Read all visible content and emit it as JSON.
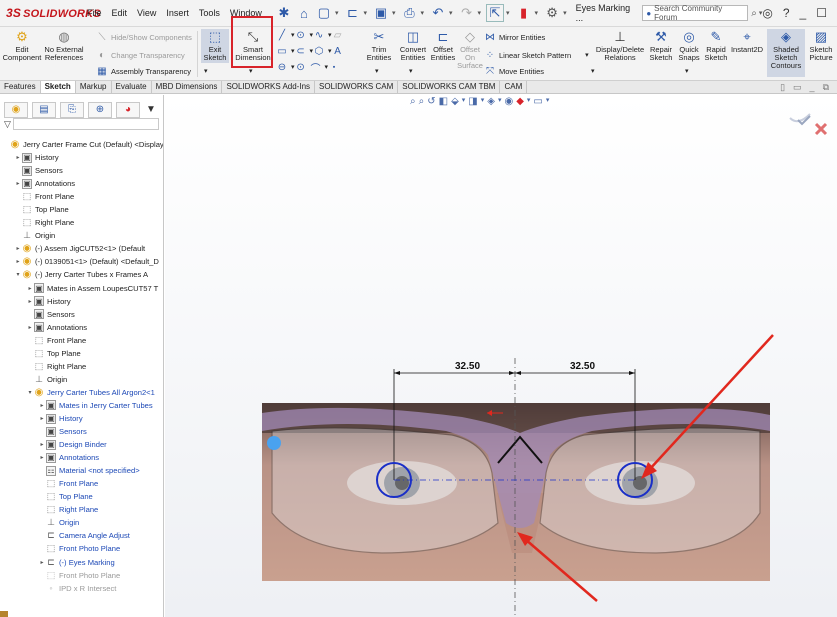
{
  "app": {
    "brand": "SOLIDWORKS",
    "brand_prefix": "3S"
  },
  "menu": [
    "File",
    "Edit",
    "View",
    "Insert",
    "Tools",
    "Window"
  ],
  "doc_title": "Eyes Marking ...",
  "search": {
    "placeholder": "Search Community Forum"
  },
  "ribbon": {
    "edit_component": "Edit Component",
    "no_external_refs": "No External References",
    "hide_show": "Hide/Show Components",
    "change_transparency": "Change Transparency",
    "assembly_transparency": "Assembly Transparency",
    "exit_sketch": "Exit Sketch",
    "smart_dimension": "Smart Dimension",
    "trim": "Trim Entities",
    "convert": "Convert Entities",
    "offset": "Offset Entities",
    "offset_surface": "Offset On Surface",
    "mirror": "Mirror Entities",
    "linear_pattern": "Linear Sketch Pattern",
    "move": "Move Entities",
    "display_delete": "Display/Delete Relations",
    "repair": "Repair Sketch",
    "quick_snaps": "Quick Snaps",
    "rapid": "Rapid Sketch",
    "instant2d": "Instant2D",
    "shaded": "Shaded Sketch Contours",
    "sketch_picture": "Sketch Picture"
  },
  "tabs": [
    "Features",
    "Sketch",
    "Markup",
    "Evaluate",
    "MBD Dimensions",
    "SOLIDWORKS Add-Ins",
    "SOLIDWORKS CAM",
    "SOLIDWORKS CAM TBM",
    "CAM"
  ],
  "active_tab": "Sketch",
  "tree": [
    {
      "label": "Jerry Carter Frame Cut (Default) <Display",
      "indent": 0,
      "icon": "part",
      "arrow": ""
    },
    {
      "label": "History",
      "indent": 1,
      "icon": "folder",
      "arrow": "▸"
    },
    {
      "label": "Sensors",
      "indent": 1,
      "icon": "folder",
      "arrow": ""
    },
    {
      "label": "Annotations",
      "indent": 1,
      "icon": "folder",
      "arrow": "▸"
    },
    {
      "label": "Front Plane",
      "indent": 1,
      "icon": "plane",
      "arrow": ""
    },
    {
      "label": "Top Plane",
      "indent": 1,
      "icon": "plane",
      "arrow": ""
    },
    {
      "label": "Right Plane",
      "indent": 1,
      "icon": "plane",
      "arrow": ""
    },
    {
      "label": "Origin",
      "indent": 1,
      "icon": "origin",
      "arrow": ""
    },
    {
      "label": "(-) Assem JigCUT52<1> (Default",
      "indent": 1,
      "icon": "part",
      "arrow": "▸"
    },
    {
      "label": "(-) 0139051<1> (Default) <Default_D",
      "indent": 1,
      "icon": "part",
      "arrow": "▸"
    },
    {
      "label": "(-) Jerry Carter Tubes x Frames A",
      "indent": 1,
      "icon": "part",
      "arrow": "▾"
    },
    {
      "label": "Mates in Assem LoupesCUT57 T",
      "indent": 2,
      "icon": "folder",
      "arrow": "▸"
    },
    {
      "label": "History",
      "indent": 2,
      "icon": "folder",
      "arrow": "▸"
    },
    {
      "label": "Sensors",
      "indent": 2,
      "icon": "folder",
      "arrow": ""
    },
    {
      "label": "Annotations",
      "indent": 2,
      "icon": "folder",
      "arrow": "▸"
    },
    {
      "label": "Front Plane",
      "indent": 2,
      "icon": "plane",
      "arrow": ""
    },
    {
      "label": "Top Plane",
      "indent": 2,
      "icon": "plane",
      "arrow": ""
    },
    {
      "label": "Right Plane",
      "indent": 2,
      "icon": "plane",
      "arrow": ""
    },
    {
      "label": "Origin",
      "indent": 2,
      "icon": "origin",
      "arrow": ""
    },
    {
      "label": "Jerry Carter Tubes All Argon2<1",
      "indent": 2,
      "icon": "part",
      "arrow": "▾",
      "blue": true
    },
    {
      "label": "Mates in Jerry Carter Tubes",
      "indent": 3,
      "icon": "folder",
      "arrow": "▸",
      "blue": true
    },
    {
      "label": "History",
      "indent": 3,
      "icon": "folder",
      "arrow": "▸",
      "blue": true
    },
    {
      "label": "Sensors",
      "indent": 3,
      "icon": "folder",
      "arrow": "",
      "blue": true
    },
    {
      "label": "Design Binder",
      "indent": 3,
      "icon": "folder",
      "arrow": "▸",
      "blue": true
    },
    {
      "label": "Annotations",
      "indent": 3,
      "icon": "folder",
      "arrow": "▸",
      "blue": true
    },
    {
      "label": "Material <not specified>",
      "indent": 3,
      "icon": "material",
      "arrow": "",
      "blue": true
    },
    {
      "label": "Front Plane",
      "indent": 3,
      "icon": "plane",
      "arrow": "",
      "blue": true
    },
    {
      "label": "Top Plane",
      "indent": 3,
      "icon": "plane",
      "arrow": "",
      "blue": true
    },
    {
      "label": "Right Plane",
      "indent": 3,
      "icon": "plane",
      "arrow": "",
      "blue": true
    },
    {
      "label": "Origin",
      "indent": 3,
      "icon": "origin",
      "arrow": "",
      "blue": true
    },
    {
      "label": "Camera Angle Adjust",
      "indent": 3,
      "icon": "sketch",
      "arrow": "",
      "blue": true
    },
    {
      "label": "Front Photo Plane",
      "indent": 3,
      "icon": "plane",
      "arrow": "",
      "blue": true
    },
    {
      "label": "(-) Eyes Marking",
      "indent": 3,
      "icon": "sketch",
      "arrow": "▸",
      "blue": true
    },
    {
      "label": "Front Photo Plane",
      "indent": 3,
      "icon": "plane",
      "arrow": "",
      "gray": true
    },
    {
      "label": "IPD x R Intersect",
      "indent": 3,
      "icon": "point",
      "arrow": "",
      "gray": true
    }
  ],
  "dimensions": {
    "left": "32.50",
    "right": "32.50"
  },
  "colors": {
    "accent_red": "#d8232a",
    "sketch_blue": "#1a2fc7",
    "tree_blue": "#1d49b6"
  }
}
